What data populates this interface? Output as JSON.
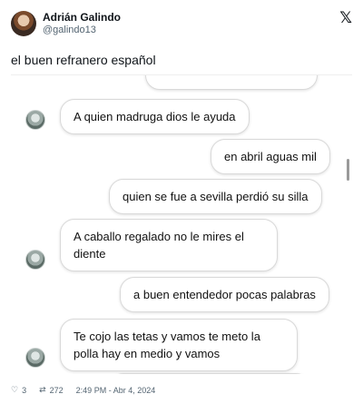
{
  "author": {
    "name": "Adrián Galindo",
    "handle": "@galindo13"
  },
  "tweet": {
    "text": "el buen refranero español"
  },
  "chat": {
    "messages": [
      {
        "side": "left",
        "text": "A quien madruga dios le ayuda"
      },
      {
        "side": "right",
        "text": "en abril aguas mil"
      },
      {
        "side": "right",
        "text": "quien se fue a sevilla perdió su silla"
      },
      {
        "side": "left",
        "text": "A caballo regalado no le mires el diente"
      },
      {
        "side": "right",
        "text": "a buen entendedor pocas palabras"
      },
      {
        "side": "left",
        "text": "Te cojo las tetas y vamos te meto la polla hay en medio y vamos"
      }
    ]
  },
  "footer": {
    "likes": "3",
    "retweets": "272",
    "timestamp": "2:49 PM - Abr 4, 2024"
  },
  "icons": {
    "x_logo": "x-logo-icon",
    "heart": "heart-icon",
    "retweet": "retweet-icon"
  }
}
